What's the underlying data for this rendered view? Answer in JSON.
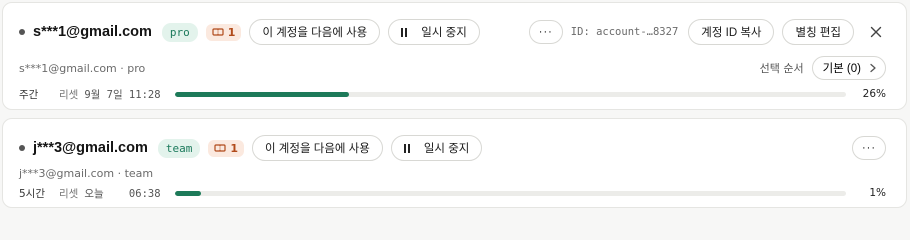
{
  "accounts": [
    {
      "email": "s***1@gmail.com",
      "plan": "pro",
      "seat_count": "1",
      "use_next_label": "이 계정을 다음에 사용",
      "pause_label": "일시 중지",
      "more_label": "···",
      "account_id": "ID: account-…8327",
      "copy_id_label": "계정 ID 복사",
      "edit_alias_label": "별칭 편집",
      "subtitle": "s***1@gmail.com · pro",
      "order_label": "선택 순서",
      "order_value": "기본 (0)",
      "usage": {
        "label": "주간",
        "reset_label": "리셋",
        "reset_time": "9월 7일 11:28",
        "percent_text": "26%",
        "percent": 26
      }
    },
    {
      "email": "j***3@gmail.com",
      "plan": "team",
      "seat_count": "1",
      "use_next_label": "이 계정을 다음에 사용",
      "pause_label": "일시 중지",
      "more_label": "···",
      "subtitle": "j***3@gmail.com · team",
      "usage": {
        "label": "5시간",
        "reset_label": "리셋",
        "reset_time": "오늘    06:38",
        "percent_text": "1%",
        "percent": 4
      }
    }
  ],
  "colors": {
    "progress_fill": "#1d7a59",
    "plan_badge_bg": "#e3f3ec",
    "seat_badge_bg": "#fbe9df"
  }
}
